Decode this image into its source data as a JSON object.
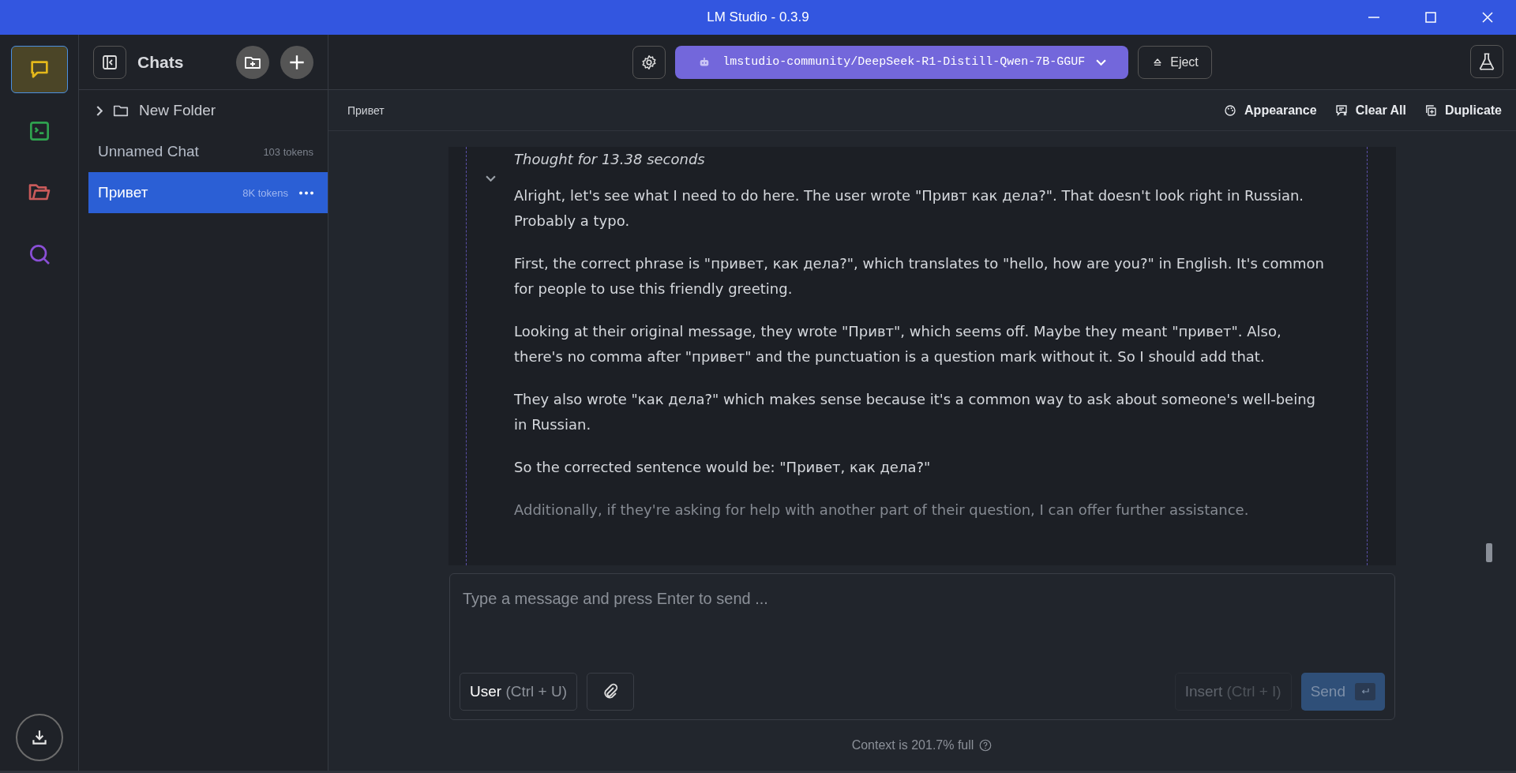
{
  "window": {
    "title": "LM Studio - 0.3.9"
  },
  "rail": [
    {
      "kind": "chat",
      "selected": true
    },
    {
      "kind": "terminal",
      "selected": false
    },
    {
      "kind": "folder",
      "selected": false
    },
    {
      "kind": "search",
      "selected": false
    },
    {
      "kind": "download",
      "selected": false
    }
  ],
  "sidebar": {
    "title": "Chats",
    "items": [
      {
        "kind": "folder",
        "label": "New Folder",
        "expanded": false
      },
      {
        "kind": "chat",
        "label": "Unnamed Chat",
        "tokens": "103 tokens",
        "selected": false
      },
      {
        "kind": "chat",
        "label": "Привет",
        "tokens": "8K tokens",
        "selected": true
      }
    ]
  },
  "toolbar": {
    "model": "lmstudio-community/DeepSeek-R1-Distill-Qwen-7B-GGUF",
    "eject": "Eject"
  },
  "chat_header": {
    "title": "Привет",
    "actions": [
      {
        "kind": "appearance",
        "label": "Appearance"
      },
      {
        "kind": "clear",
        "label": "Clear All"
      },
      {
        "kind": "duplicate",
        "label": "Duplicate"
      }
    ]
  },
  "thought": {
    "heading": "Thought for 13.38 seconds",
    "expanded": true,
    "paragraphs": [
      "Alright, let's see what I need to do here. The user wrote \"Привт как дела?\". That doesn't look right in Russian. Probably a typo.",
      "First, the correct phrase is \"привет, как дела?\", which translates to \"hello, how are you?\" in English. It's common for people to use this friendly greeting.",
      "Looking at their original message, they wrote \"Привт\", which seems off. Maybe they meant \"привет\". Also, there's no comma after \"привет\" and the punctuation is a question mark without it. So I should add that.",
      "They also wrote \"как дела?\" which makes sense because it's a common way to ask about someone's well-being in Russian.",
      "So the corrected sentence would be: \"Привет, как дела?\"",
      "Additionally, if they're asking for help with another part of their question, I can offer further assistance."
    ]
  },
  "composer": {
    "placeholder": "Type a message and press Enter to send ...",
    "role": "User",
    "role_shortcut": "(Ctrl + U)",
    "insert": "Insert",
    "insert_shortcut": "(Ctrl + I)",
    "insert_disabled": true,
    "send": "Send",
    "send_disabled": true
  },
  "context": "Context is 201.7% full"
}
